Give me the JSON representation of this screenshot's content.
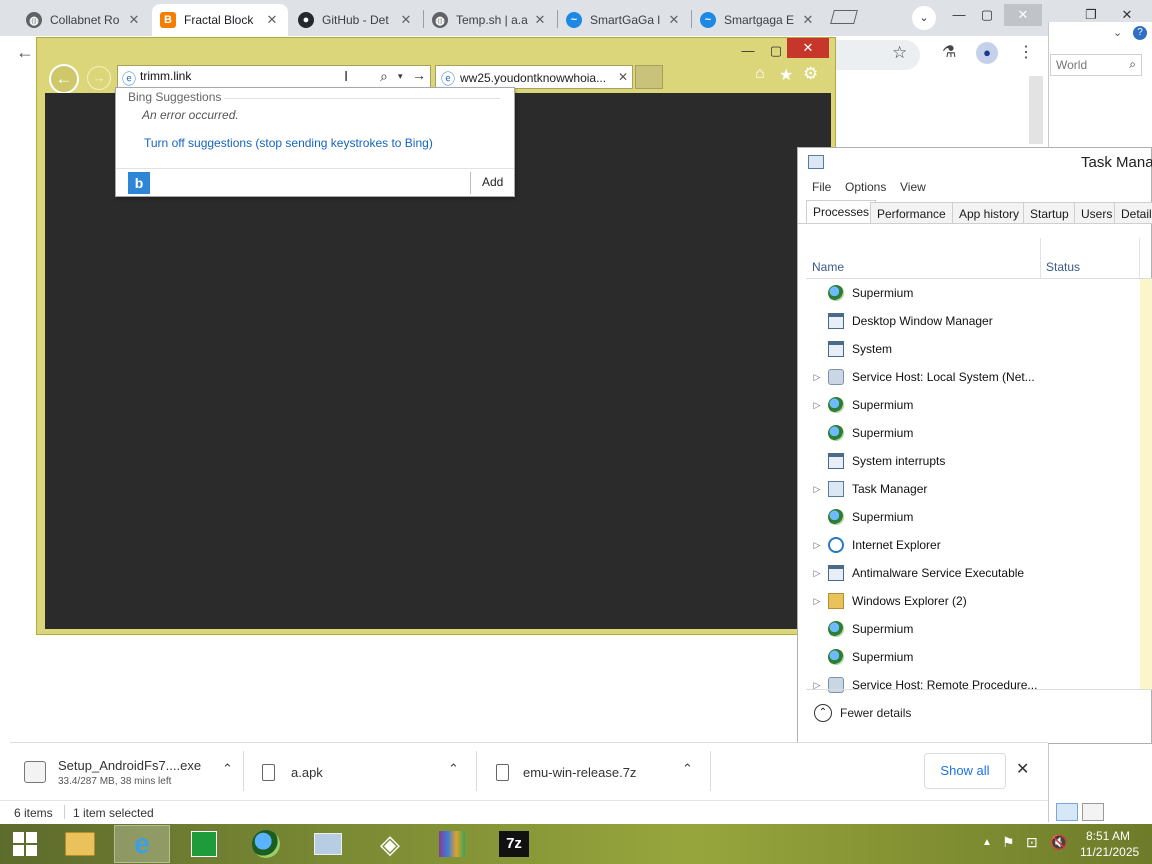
{
  "chrome": {
    "tabs": [
      {
        "title": "Collabnet Ro",
        "icon": "globe-icon"
      },
      {
        "title": "Fractal Block",
        "icon": "blogger-icon"
      },
      {
        "title": "GitHub - Det",
        "icon": "github-icon"
      },
      {
        "title": "Temp.sh | a.a",
        "icon": "globe-icon"
      },
      {
        "title": "SmartGaGa l",
        "icon": "smartgaga-icon"
      },
      {
        "title": "Smartgaga E",
        "icon": "smartgaga-icon"
      }
    ]
  },
  "explorer": {
    "search_placeholder": "World",
    "status_items": "6 items",
    "status_selected": "1 item selected"
  },
  "ie": {
    "address_value": "trimm.link",
    "tab_title": "ww25.youdontknowwhoia...",
    "suggestions": {
      "header": "Bing Suggestions",
      "error": "An error occurred.",
      "turn_off": "Turn off suggestions (stop sending keystrokes to Bing)",
      "add": "Add"
    },
    "colors": {
      "frame": "#dcd67a",
      "content": "#2b2b2b",
      "link": "#1565c0"
    }
  },
  "downloads": {
    "items": [
      {
        "name": "Setup_AndroidFs7....exe",
        "sub": "33.4/287 MB, 38 mins left"
      },
      {
        "name": "a.apk"
      },
      {
        "name": "emu-win-release.7z"
      }
    ],
    "show_all": "Show all"
  },
  "taskmgr": {
    "title": "Task Mana",
    "menu": [
      "File",
      "Options",
      "View"
    ],
    "tabs": [
      "Processes",
      "Performance",
      "App history",
      "Startup",
      "Users",
      "Details"
    ],
    "columns": {
      "name": "Name",
      "status": "Status"
    },
    "processes": [
      {
        "name": "Supermium",
        "icon": "supermium-icon",
        "expandable": false
      },
      {
        "name": "Desktop Window Manager",
        "icon": "window-icon",
        "expandable": false
      },
      {
        "name": "System",
        "icon": "window-icon",
        "expandable": false
      },
      {
        "name": "Service Host: Local System (Net...",
        "icon": "gear-icon",
        "expandable": true
      },
      {
        "name": "Supermium",
        "icon": "supermium-icon",
        "expandable": true
      },
      {
        "name": "Supermium",
        "icon": "supermium-icon",
        "expandable": false
      },
      {
        "name": "System interrupts",
        "icon": "window-icon",
        "expandable": false
      },
      {
        "name": "Task Manager",
        "icon": "taskmgr-icon",
        "expandable": true
      },
      {
        "name": "Supermium",
        "icon": "supermium-icon",
        "expandable": false
      },
      {
        "name": "Internet Explorer",
        "icon": "ie-icon",
        "expandable": true
      },
      {
        "name": "Antimalware Service Executable",
        "icon": "window-icon",
        "expandable": true
      },
      {
        "name": "Windows Explorer (2)",
        "icon": "folder-icon",
        "expandable": true
      },
      {
        "name": "Supermium",
        "icon": "supermium-icon",
        "expandable": false
      },
      {
        "name": "Supermium",
        "icon": "supermium-icon",
        "expandable": false
      },
      {
        "name": "Service Host: Remote Procedure...",
        "icon": "gear-icon",
        "expandable": true
      }
    ],
    "fewer_details": "Fewer details"
  },
  "taskbar": {
    "time": "8:51 AM",
    "date": "11/21/2025"
  }
}
